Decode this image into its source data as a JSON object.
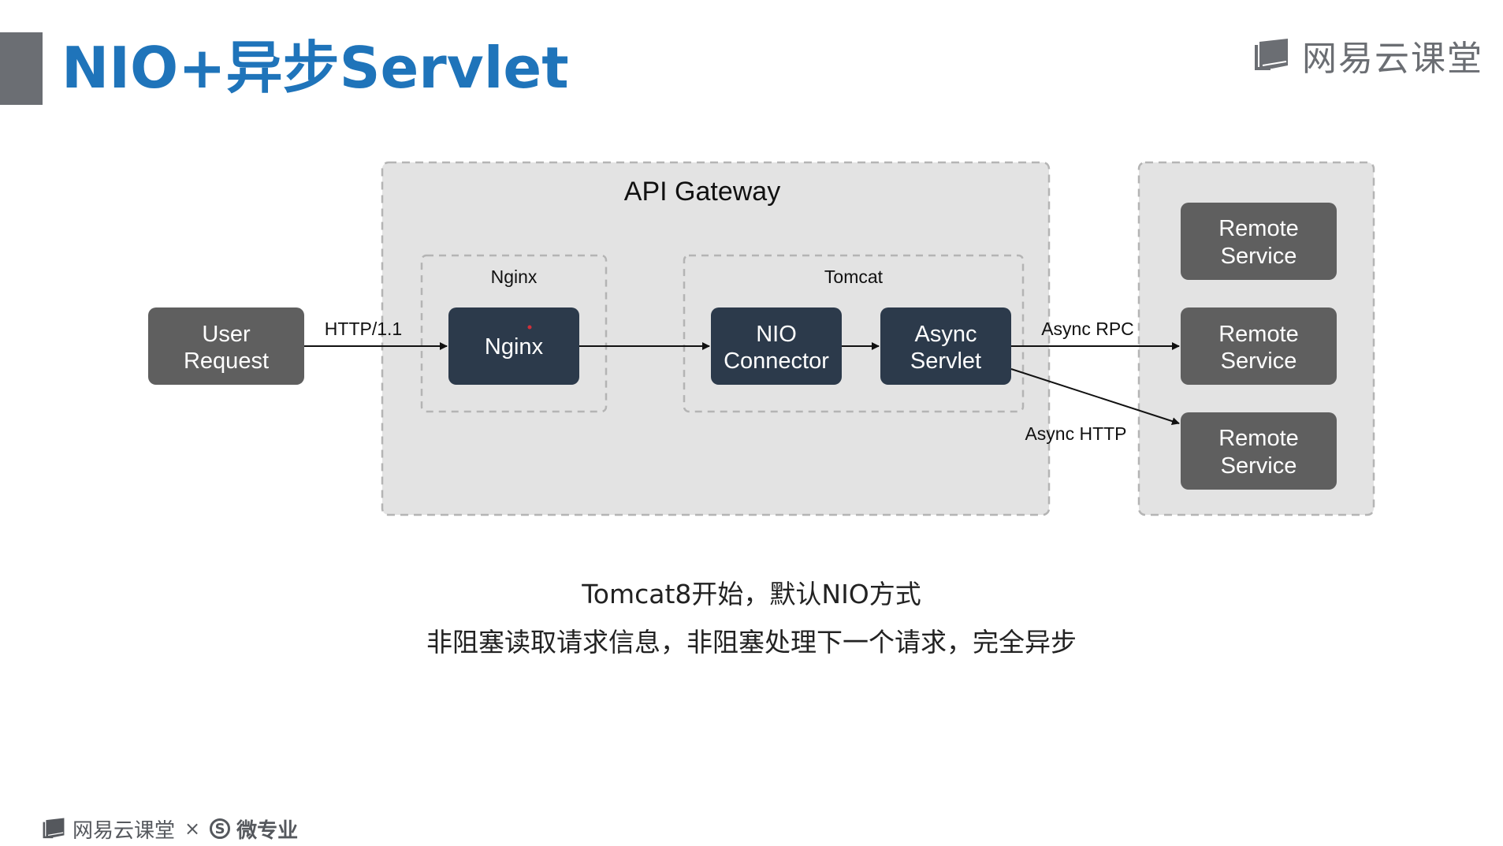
{
  "slide": {
    "title": "NIO+异步Servlet",
    "brand": "网易云课堂",
    "footer_brand_left": "网易云课堂",
    "footer_times": "×",
    "footer_s_logo": "S",
    "footer_brand_right": "微专业"
  },
  "diagram": {
    "gateway_label": "API Gateway",
    "nginx_group_label": "Nginx",
    "tomcat_group_label": "Tomcat",
    "user_request": [
      "User",
      "Request"
    ],
    "nginx_node": "Nginx",
    "nio_connector": [
      "NIO",
      "Connector"
    ],
    "async_servlet": [
      "Async",
      "Servlet"
    ],
    "remote_services": [
      [
        "Remote",
        "Service"
      ],
      [
        "Remote",
        "Service"
      ],
      [
        "Remote",
        "Service"
      ]
    ],
    "edge_http": "HTTP/1.1",
    "edge_async_rpc": "Async RPC",
    "edge_async_http": "Async HTTP",
    "colors": {
      "gray_node": "#5f5f5f",
      "dark_node": "#2c3a4b",
      "container_fill": "#e3e3e3",
      "dashed_border": "#b4b4b4"
    }
  },
  "captions": {
    "line1": "Tomcat8开始，默认NIO方式",
    "line2": "非阻塞读取请求信息，非阻塞处理下一个请求，完全异步"
  }
}
